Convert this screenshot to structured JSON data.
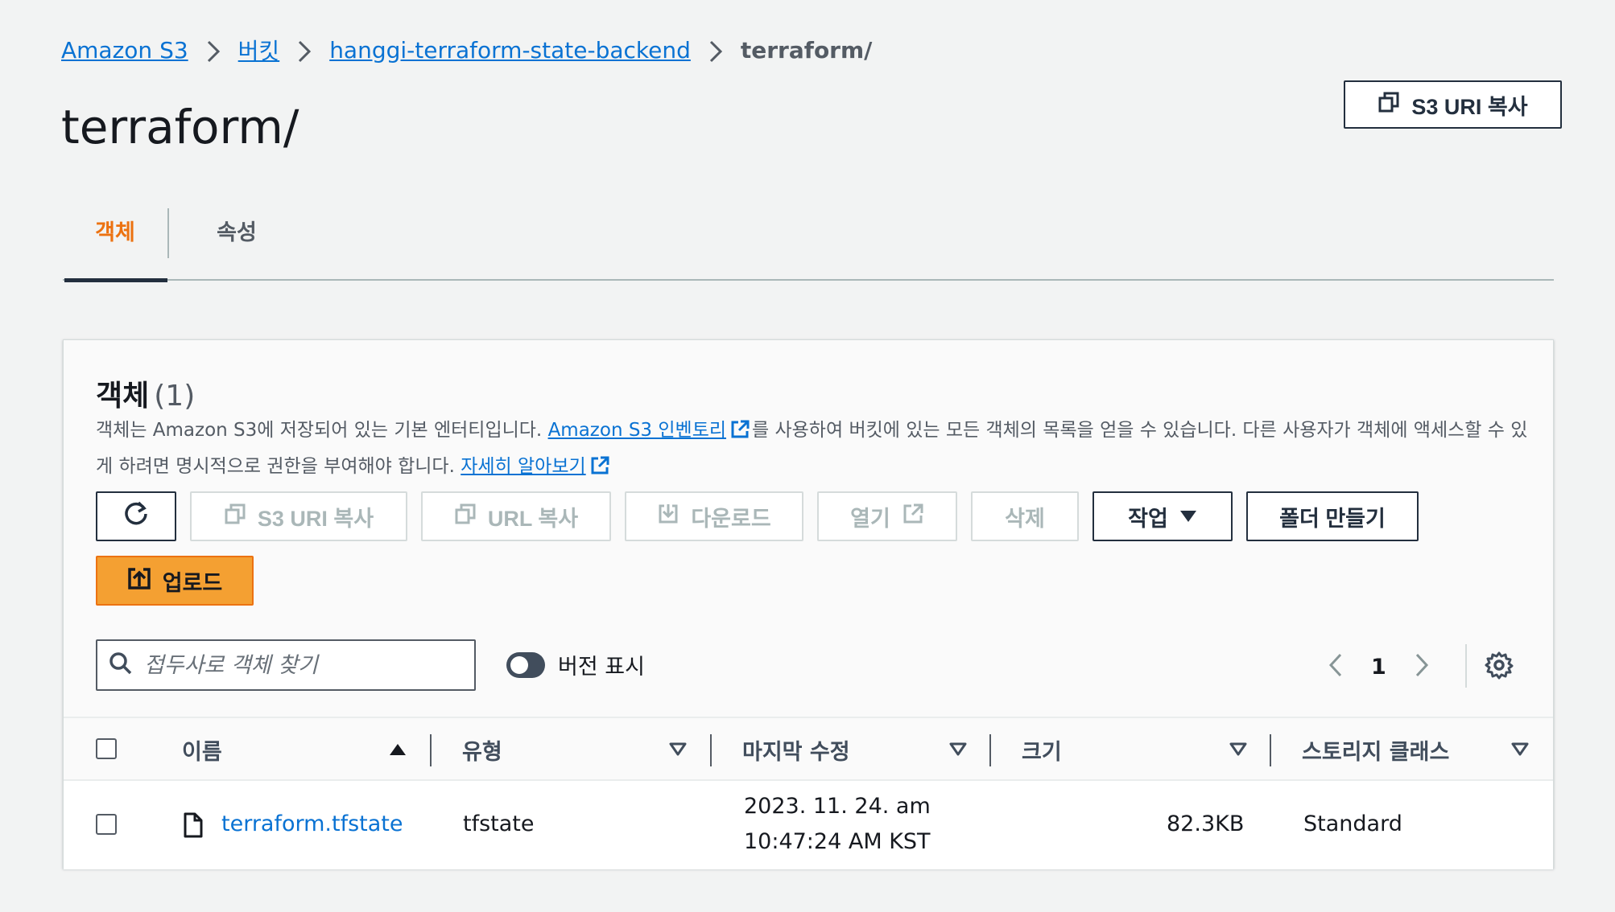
{
  "breadcrumb": {
    "items": [
      "Amazon S3",
      "버킷",
      "hanggi-terraform-state-backend"
    ],
    "current": "terraform/"
  },
  "page": {
    "title": "terraform/",
    "copy_uri_label": "S3 URI 복사"
  },
  "tabs": [
    {
      "label": "객체",
      "active": true
    },
    {
      "label": "속성",
      "active": false
    }
  ],
  "objects_panel": {
    "title": "객체",
    "count": "(1)",
    "desc_part1": "객체는 Amazon S3에 저장되어 있는 기본 엔터티입니다. ",
    "desc_link1": "Amazon S3 인벤토리",
    "desc_part2": "를 사용하여 버킷에 있는 모든 객체의 목록을 얻을 수 있습니다. 다른 사용자가 객체에 액세스할 수 있게 하려면 명시적으로 권한을 부여해야 합니다. ",
    "desc_link2": "자세히 알아보기"
  },
  "toolbar": {
    "refresh_icon": "refresh-icon",
    "s3uri_label": "S3 URI 복사",
    "url_label": "URL 복사",
    "download_label": "다운로드",
    "open_label": "열기",
    "delete_label": "삭제",
    "actions_label": "작업",
    "create_folder_label": "폴더 만들기",
    "upload_label": "업로드"
  },
  "search": {
    "placeholder": "접두사로 객체 찾기",
    "value": ""
  },
  "versions_toggle": {
    "label": "버전 표시",
    "on": false
  },
  "pagination": {
    "current_page": "1"
  },
  "table": {
    "columns": [
      "이름",
      "유형",
      "마지막 수정",
      "크기",
      "스토리지 클래스"
    ],
    "rows": [
      {
        "name": "terraform.tfstate",
        "type": "tfstate",
        "modified_line1": "2023. 11. 24. am",
        "modified_line2": "10:47:24 AM KST",
        "size": "82.3KB",
        "storage_class": "Standard"
      }
    ]
  },
  "colors": {
    "link": "#0972d3",
    "accent_orange": "#ec7211",
    "upload_fill": "#f4a032",
    "text_dark": "#16191f",
    "disabled": "#aab7b8"
  }
}
